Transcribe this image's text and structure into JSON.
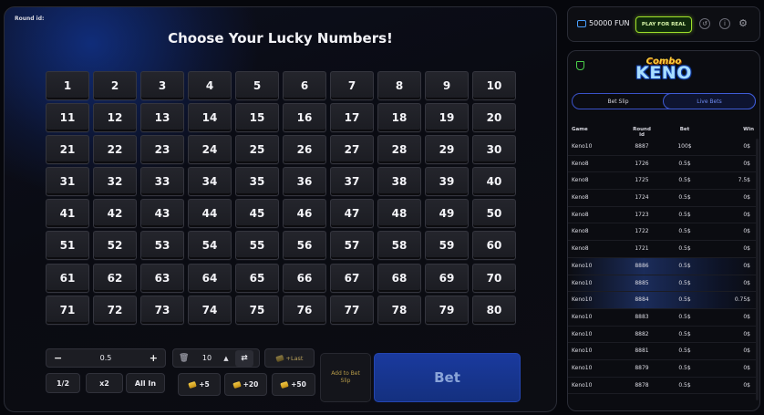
{
  "game": {
    "round_label": "Round id:",
    "title": "Choose Your Lucky Numbers!",
    "numbers": [
      "1",
      "2",
      "3",
      "4",
      "5",
      "6",
      "7",
      "8",
      "9",
      "10",
      "11",
      "12",
      "13",
      "14",
      "15",
      "16",
      "17",
      "18",
      "19",
      "20",
      "21",
      "22",
      "23",
      "24",
      "25",
      "26",
      "27",
      "28",
      "29",
      "30",
      "31",
      "32",
      "33",
      "34",
      "35",
      "36",
      "37",
      "38",
      "39",
      "40",
      "41",
      "42",
      "43",
      "44",
      "45",
      "46",
      "47",
      "48",
      "49",
      "50",
      "51",
      "52",
      "53",
      "54",
      "55",
      "56",
      "57",
      "58",
      "59",
      "60",
      "61",
      "62",
      "63",
      "64",
      "65",
      "66",
      "67",
      "68",
      "69",
      "70",
      "71",
      "72",
      "73",
      "74",
      "75",
      "76",
      "77",
      "78",
      "79",
      "80"
    ]
  },
  "controls": {
    "stake_minus": "−",
    "stake_value": "0.5",
    "stake_plus": "+",
    "half": "1/2",
    "double": "x2",
    "all_in": "All In",
    "auto_count": "10",
    "last": "+Last",
    "plus5": "+5",
    "plus20": "+20",
    "plus50": "+50",
    "add_to_slip": "Add to Bet Slip",
    "bet": "Bet"
  },
  "topbar": {
    "balance": "50000 FUN",
    "play_for_real": "PLAY FOR REAL"
  },
  "side": {
    "logo_top": "Combo",
    "logo_main": "KENO",
    "tabs": [
      "Bet Slip",
      "Live Bets"
    ],
    "headers": {
      "game": "Game",
      "round": "Round id",
      "bet": "Bet",
      "win": "Win"
    },
    "rows": [
      {
        "game": "Keno10",
        "round": "8887",
        "bet": "100$",
        "win": "0$"
      },
      {
        "game": "Keno8",
        "round": "1726",
        "bet": "0.5$",
        "win": "0$"
      },
      {
        "game": "Keno8",
        "round": "1725",
        "bet": "0.5$",
        "win": "7.5$"
      },
      {
        "game": "Keno8",
        "round": "1724",
        "bet": "0.5$",
        "win": "0$"
      },
      {
        "game": "Keno8",
        "round": "1723",
        "bet": "0.5$",
        "win": "0$"
      },
      {
        "game": "Keno8",
        "round": "1722",
        "bet": "0.5$",
        "win": "0$"
      },
      {
        "game": "Keno8",
        "round": "1721",
        "bet": "0.5$",
        "win": "0$"
      },
      {
        "game": "Keno10",
        "round": "8886",
        "bet": "0.5$",
        "win": "0$"
      },
      {
        "game": "Keno10",
        "round": "8885",
        "bet": "0.5$",
        "win": "0$"
      },
      {
        "game": "Keno10",
        "round": "8884",
        "bet": "0.5$",
        "win": "0.75$"
      },
      {
        "game": "Keno10",
        "round": "8883",
        "bet": "0.5$",
        "win": "0$"
      },
      {
        "game": "Keno10",
        "round": "8882",
        "bet": "0.5$",
        "win": "0$"
      },
      {
        "game": "Keno10",
        "round": "8881",
        "bet": "0.5$",
        "win": "0$"
      },
      {
        "game": "Keno10",
        "round": "8879",
        "bet": "0.5$",
        "win": "0$"
      },
      {
        "game": "Keno10",
        "round": "8878",
        "bet": "0.5$",
        "win": "0$"
      }
    ]
  }
}
